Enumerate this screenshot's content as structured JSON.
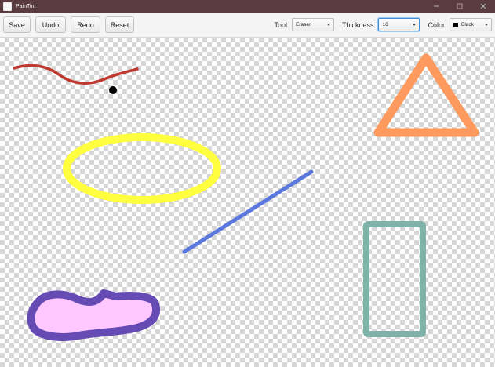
{
  "window": {
    "title": "PainTint"
  },
  "toolbar": {
    "buttons": {
      "save": "Save",
      "undo": "Undo",
      "redo": "Redo",
      "reset": "Reset"
    },
    "tool": {
      "label": "Tool",
      "value": "Eraser"
    },
    "thickness": {
      "label": "Thickness",
      "value": "16"
    },
    "color": {
      "label": "Color",
      "value": "Black",
      "swatch": "#000000"
    }
  },
  "canvas": {
    "strokes": [
      {
        "kind": "wave-line",
        "color": "#c0392f"
      },
      {
        "kind": "dot",
        "color": "#000000"
      },
      {
        "kind": "triangle",
        "color": "#ff9a5f"
      },
      {
        "kind": "ellipse",
        "color": "#ffff40"
      },
      {
        "kind": "line",
        "color": "#5b78df"
      },
      {
        "kind": "rectangle",
        "color": "#7fb2a9"
      },
      {
        "kind": "filled-blob",
        "color": "#ffc7ff",
        "outline": "#674bb4"
      }
    ]
  }
}
